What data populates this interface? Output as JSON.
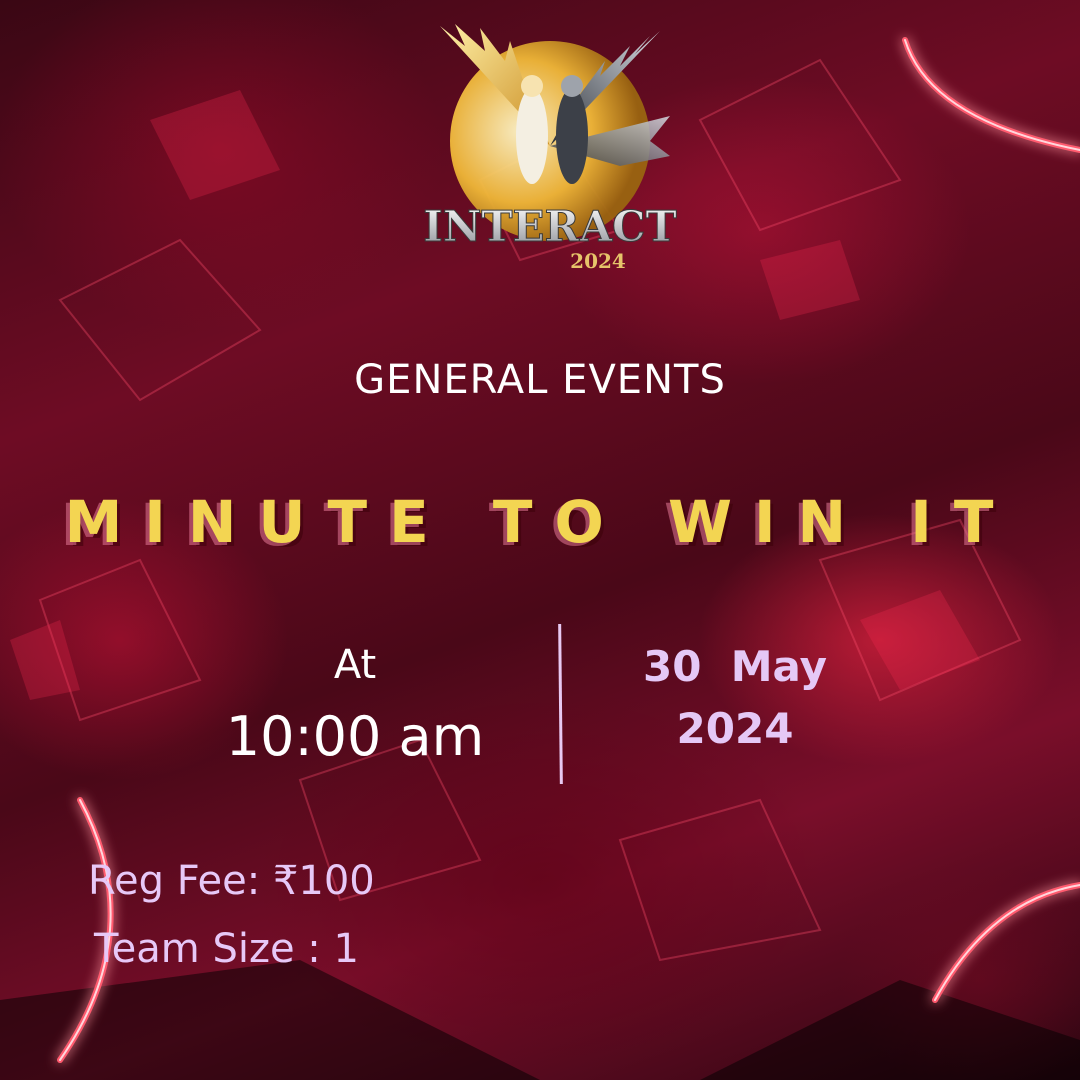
{
  "logo": {
    "icon": "angel-and-dark-angel-emblem",
    "wordmark": "INTERACT",
    "year": "2024"
  },
  "category": "GENERAL EVENTS",
  "event_title": "MINUTE TO WIN IT",
  "schedule": {
    "at_label": "At",
    "time": "10:00 am",
    "date_line1": "30  May",
    "date_line2": "2024"
  },
  "registration": {
    "fee": "Reg Fee: ₹100",
    "team_size": "Team Size : 1"
  },
  "colors": {
    "background": "#5a0a1e",
    "title": "#f3d552",
    "accent_text": "#e5c8f6",
    "neon": "#ff5a6e"
  }
}
